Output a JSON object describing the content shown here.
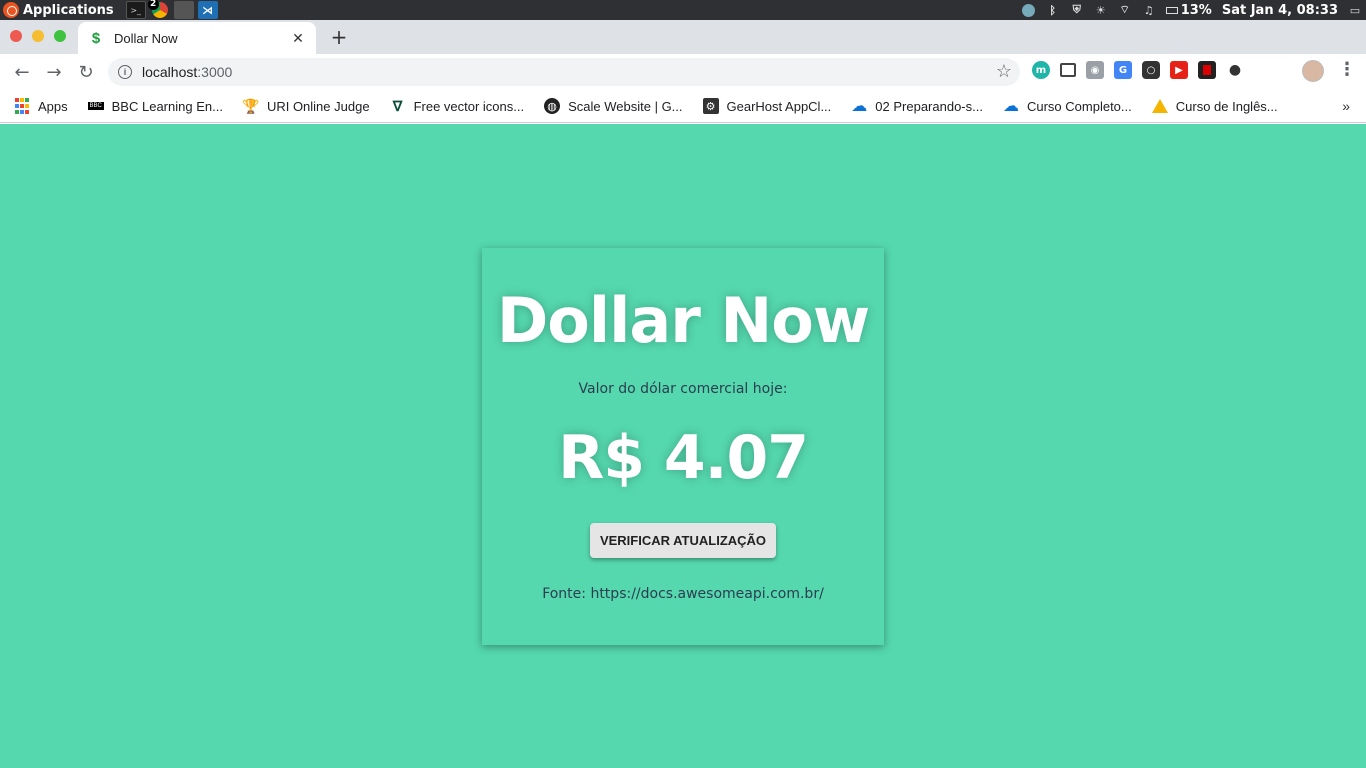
{
  "os": {
    "apps_label": "Applications",
    "badge": "2",
    "battery": "13%",
    "clock": "Sat Jan  4, 08:33"
  },
  "browser": {
    "tab_title": "Dollar Now",
    "tab_icon": "$",
    "close_glyph": "✕",
    "new_tab_glyph": "+",
    "url_host": "localhost",
    "url_port": ":3000",
    "bookmarks": [
      {
        "label": "Apps",
        "icon": "apps-grid-icon"
      },
      {
        "label": "BBC Learning En...",
        "icon": "bbc-icon"
      },
      {
        "label": "URI Online Judge",
        "icon": "trophy-icon"
      },
      {
        "label": "Free vector icons...",
        "icon": "flaticon-icon"
      },
      {
        "label": "Scale Website | G...",
        "icon": "globe-icon"
      },
      {
        "label": "GearHost AppCl...",
        "icon": "gear-icon"
      },
      {
        "label": "02 Preparando-s...",
        "icon": "onedrive-icon"
      },
      {
        "label": "Curso Completo...",
        "icon": "onedrive-icon"
      },
      {
        "label": "Curso de Inglês...",
        "icon": "google-drive-icon"
      }
    ],
    "more_glyph": "»"
  },
  "app": {
    "title": "Dollar Now",
    "subtitle": "Valor do dólar comercial hoje:",
    "price": "R$ 4.07",
    "button_label": "VERIFICAR ATUALIZAÇÃO",
    "source": "Fonte: https://docs.awesomeapi.com.br/"
  },
  "colors": {
    "background": "#55d8ae",
    "title_text": "#ffffff",
    "body_text": "#2c3e50",
    "button_bg": "#e5e5e5"
  }
}
